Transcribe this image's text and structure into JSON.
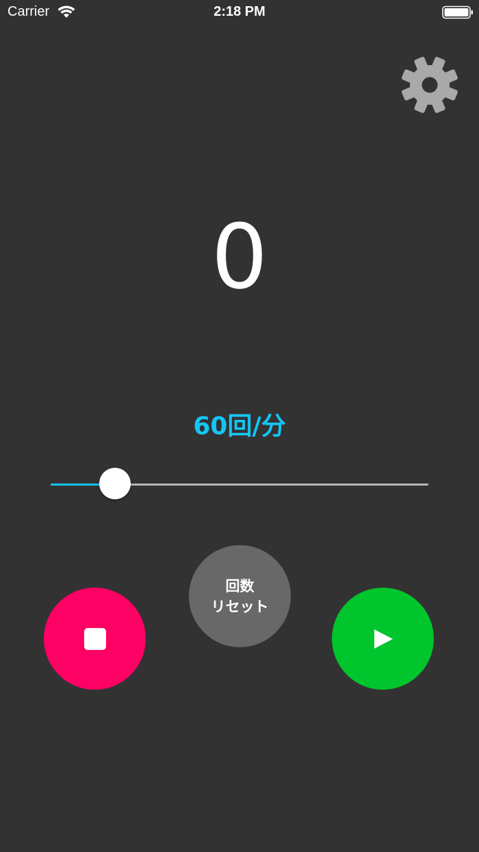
{
  "status_bar": {
    "carrier": "Carrier",
    "time": "2:18 PM",
    "icons": [
      "wifi-icon",
      "battery-icon"
    ]
  },
  "toolbar": {
    "settings_icon": "gear-icon"
  },
  "counter": {
    "value": "0"
  },
  "tempo": {
    "label": "60回/分",
    "slider_fraction": 0.17
  },
  "controls": {
    "reset_label_line1": "回数",
    "reset_label_line2": "リセット",
    "stop_icon": "stop-icon",
    "play_icon": "play-icon"
  },
  "colors": {
    "background": "#333233",
    "accent": "#13c6f5",
    "stop": "#fe0165",
    "play": "#00c52c",
    "reset": "#686868",
    "settings_icon": "#a9a9a9"
  }
}
